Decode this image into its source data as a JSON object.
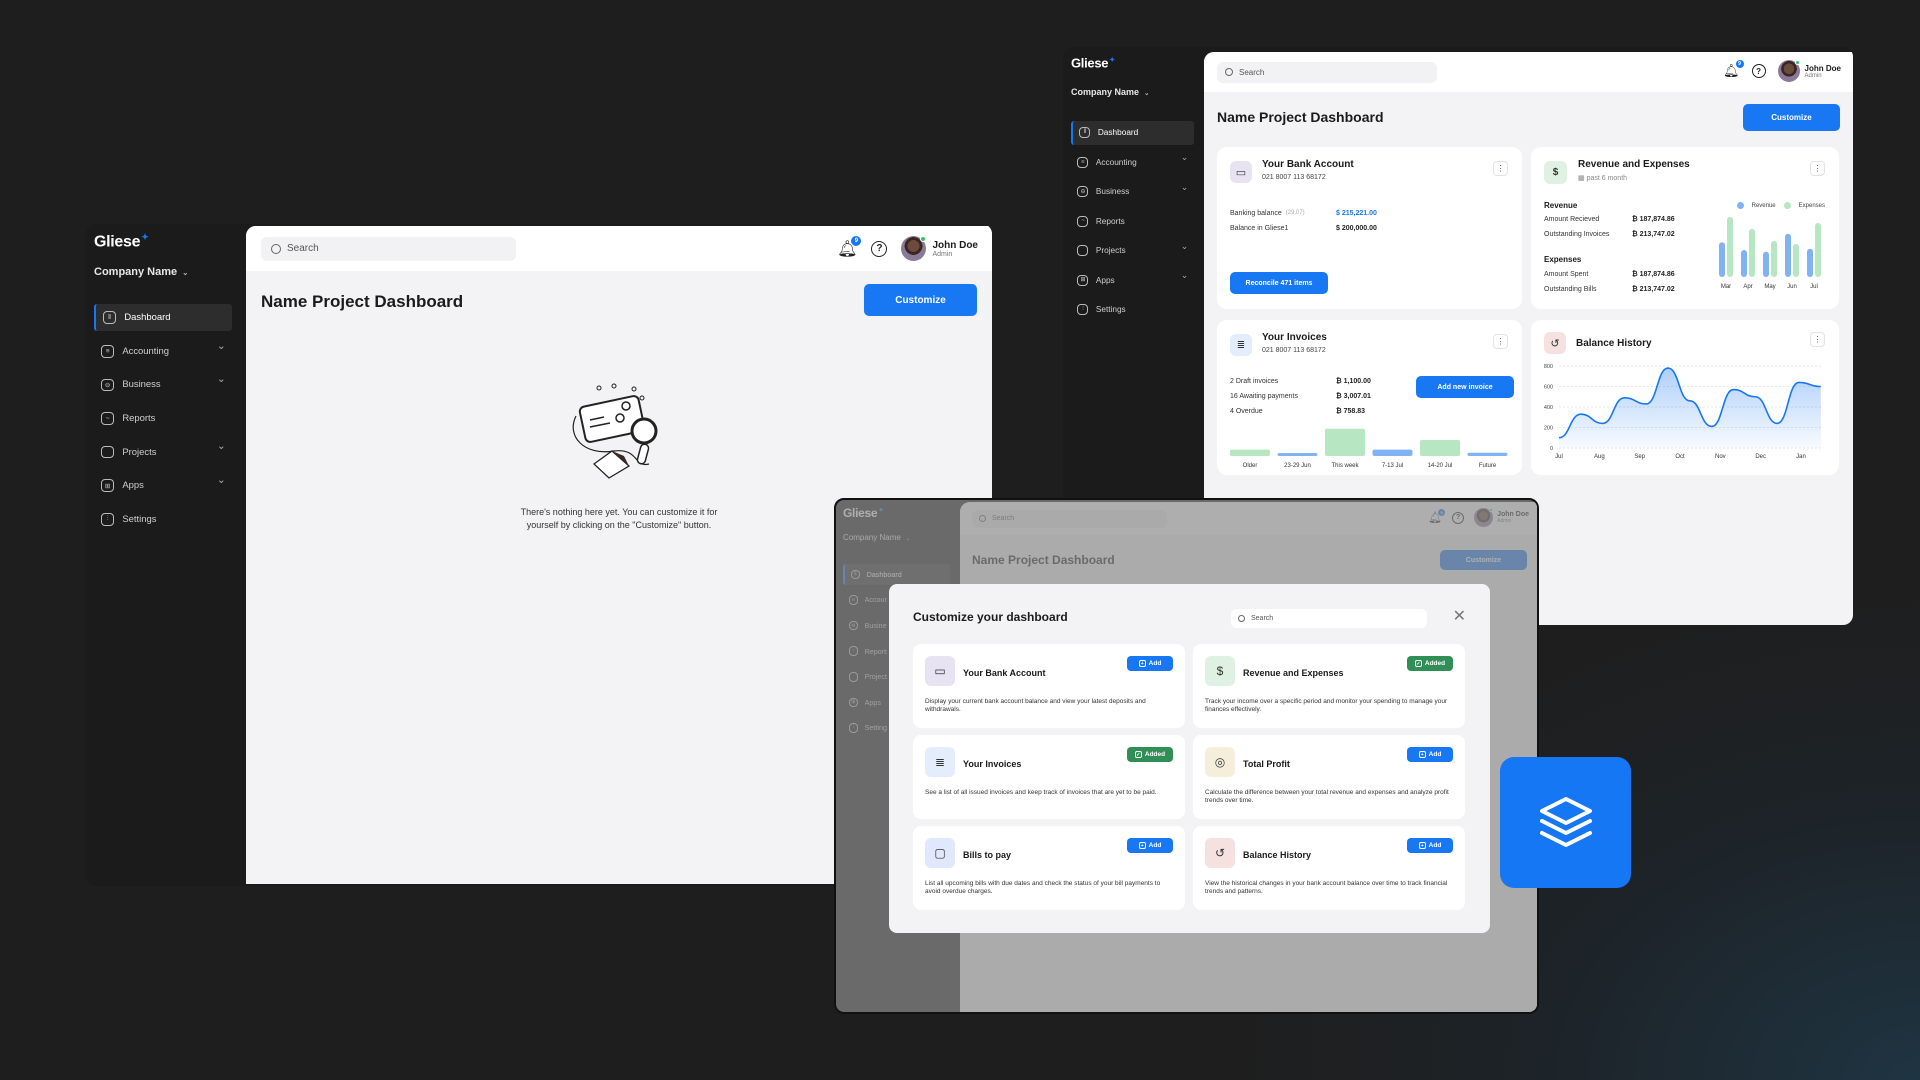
{
  "brand": {
    "name": "Gliese",
    "company": "Company Name"
  },
  "nav": [
    {
      "label": "Dashboard",
      "icon": "dashboard-icon",
      "glyph": "⫴",
      "active": true,
      "expandable": false
    },
    {
      "label": "Accounting",
      "icon": "receipt-icon",
      "glyph": "≡",
      "active": false,
      "expandable": true
    },
    {
      "label": "Business",
      "icon": "briefcase-icon",
      "glyph": "⊖",
      "active": false,
      "expandable": true
    },
    {
      "label": "Reports",
      "icon": "chart-icon",
      "glyph": "~",
      "active": false,
      "expandable": false
    },
    {
      "label": "Projects",
      "icon": "folder-icon",
      "glyph": " ",
      "active": false,
      "expandable": true
    },
    {
      "label": "Apps",
      "icon": "apps-icon",
      "glyph": "⊞",
      "active": false,
      "expandable": true
    },
    {
      "label": "Settings",
      "icon": "sliders-icon",
      "glyph": "⫶",
      "active": false,
      "expandable": false
    }
  ],
  "header": {
    "search_placeholder": "Search",
    "notifications": "9",
    "help": "?",
    "user_name": "John Doe",
    "user_role": "Admin",
    "chevron": "⌄"
  },
  "page": {
    "title": "Name Project Dashboard",
    "customize": "Customize"
  },
  "empty_state": {
    "line1": "There's nothing here yet. You can customize it for",
    "line2": "yourself by clicking on the \"Customize\" button."
  },
  "bank": {
    "title": "Your Bank Account",
    "account": "021 8007 113 68172",
    "banking_label": "Banking balance",
    "banking_date": "(29.07)",
    "banking_value": "$ 215,221.00",
    "gliese_label": "Balance in Gliese1",
    "gliese_value": "$ 200,000.00",
    "reconcile": "Reconcile 471 items"
  },
  "revexp": {
    "title": "Revenue and Expenses",
    "period": "past 6 month",
    "revenue_heading": "Revenue",
    "received_label": "Amount Recieved",
    "received_value": "₿ 187,874.86",
    "outstanding_inv_label": "Outstanding Invoices",
    "outstanding_inv_value": "₿ 213,747.02",
    "expenses_heading": "Expenses",
    "spent_label": "Amount Spent",
    "spent_value": "₿ 187,874.86",
    "bills_label": "Outstanding Bills",
    "bills_value": "₿ 213,747.02",
    "legend_revenue": "Revenue",
    "legend_expenses": "Expenses"
  },
  "invoices": {
    "title": "Your Invoices",
    "account": "021 8007 113 68172",
    "draft_label": "2 Draft invoices",
    "draft_value": "₿ 1,100.00",
    "awaiting_label": "16 Awaiting payments",
    "awaiting_value": "₿ 3,007.01",
    "overdue_label": "4 Overdue",
    "overdue_value": "₿ 758.83",
    "add": "Add new invoice"
  },
  "balance": {
    "title": "Balance History"
  },
  "chart_data": [
    {
      "type": "bar",
      "title": "Revenue and Expenses",
      "categories": [
        "Mar",
        "Apr",
        "May",
        "Jun",
        "Jul"
      ],
      "series": [
        {
          "name": "Revenue",
          "color": "#7fb3f5",
          "values": [
            58,
            45,
            42,
            72,
            47
          ]
        },
        {
          "name": "Expenses",
          "color": "#b6e6c2",
          "values": [
            100,
            80,
            60,
            55,
            90
          ]
        }
      ],
      "legend": "top-right"
    },
    {
      "type": "bar",
      "title": "Your Invoices",
      "categories": [
        "Older",
        "23-29 Jun",
        "This week",
        "7-13 Jul",
        "14-20 Jul",
        "Future"
      ],
      "values": [
        20,
        5,
        85,
        20,
        50,
        10
      ],
      "colors": [
        "#b6e6c2",
        "#7fb3f5",
        "#b6e6c2",
        "#7fb3f5",
        "#b6e6c2",
        "#7fb3f5"
      ]
    },
    {
      "type": "area",
      "title": "Balance History",
      "x": [
        "Jul",
        "",
        "Aug",
        "",
        "Sep",
        "",
        "Oct",
        "",
        "Nov",
        "",
        "Dec",
        "",
        "Jan",
        ""
      ],
      "values": [
        100,
        330,
        240,
        490,
        430,
        780,
        460,
        210,
        570,
        500,
        240,
        640,
        600
      ],
      "xticks": [
        "Jul",
        "Aug",
        "Sep",
        "Oct",
        "Nov",
        "Dec",
        "Jan"
      ],
      "yticks": [
        0,
        200,
        400,
        600,
        800
      ],
      "ylim": [
        0,
        800
      ],
      "color": "#1877f2"
    }
  ],
  "modal": {
    "title": "Customize your dashboard",
    "search_placeholder": "Search",
    "close": "✕",
    "widgets": [
      {
        "title": "Your Bank Account",
        "desc": "Display your current bank account balance and view your latest deposits and withdrawals.",
        "state": "Add",
        "icon": "wallet-icon",
        "bg": "#e8e3f3",
        "glyph": "▭"
      },
      {
        "title": "Revenue and Expenses",
        "desc": "Track your income over a specific period and monitor your spending to manage your finances effectively.",
        "state": "Added",
        "icon": "revenue-icon",
        "bg": "#dff1e3",
        "glyph": "$"
      },
      {
        "title": "Your Invoices",
        "desc": "See a list of all issued invoices and keep track of invoices that are yet to be paid.",
        "state": "Added",
        "icon": "invoice-icon",
        "bg": "#e3edfb",
        "glyph": "≣"
      },
      {
        "title": "Total Profit",
        "desc": "Calculate the difference between your total revenue and expenses and analyze profit trends over time.",
        "state": "Add",
        "icon": "coins-icon",
        "bg": "#f5eedb",
        "glyph": "◎"
      },
      {
        "title": "Bills to pay",
        "desc": "List all upcoming bills with due dates and check the status of your bill payments to avoid overdue charges.",
        "state": "Add",
        "icon": "bill-icon",
        "bg": "#e1e8fb",
        "glyph": "▢"
      },
      {
        "title": "Balance History",
        "desc": "View the historical changes in your bank account balance over time to track financial trends and patterns.",
        "state": "Add",
        "icon": "history-icon",
        "bg": "#f6e1e1",
        "glyph": "↺"
      }
    ]
  },
  "colors": {
    "accent": "#1877f2",
    "added": "#2f8f57",
    "sidebar": "#1b1b1b",
    "content": "#f3f3f5"
  }
}
